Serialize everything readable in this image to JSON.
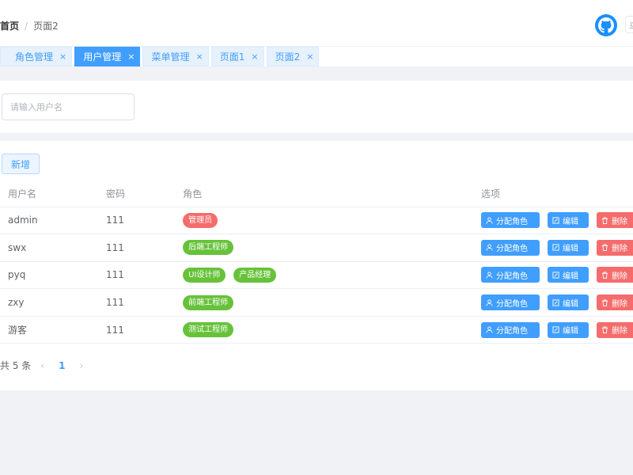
{
  "breadcrumb": {
    "home": "首页",
    "sep": "/",
    "current": "页面2"
  },
  "tabs": [
    {
      "label": "角色管理",
      "close": "×"
    },
    {
      "label": "用户管理",
      "close": "×",
      "active": true
    },
    {
      "label": "菜单管理",
      "close": "×"
    },
    {
      "label": "页面1",
      "close": "×"
    },
    {
      "label": "页面2",
      "close": "×"
    }
  ],
  "header": {
    "user_button_text": "马"
  },
  "search": {
    "placeholder": "请输入用户名"
  },
  "toolbar": {
    "add_label": "新增"
  },
  "table": {
    "headers": [
      "用户名",
      "密码",
      "角色",
      "选项"
    ],
    "rows": [
      {
        "username": "admin",
        "password": "111",
        "roles": [
          {
            "label": "管理员",
            "color": "red"
          }
        ]
      },
      {
        "username": "swx",
        "password": "111",
        "roles": [
          {
            "label": "后端工程师",
            "color": "green"
          }
        ]
      },
      {
        "username": "pyq",
        "password": "111",
        "roles": [
          {
            "label": "UI设计师",
            "color": "green"
          },
          {
            "label": "产品经理",
            "color": "green"
          }
        ]
      },
      {
        "username": "zxy",
        "password": "111",
        "roles": [
          {
            "label": "前端工程师",
            "color": "green"
          }
        ]
      },
      {
        "username": "游客",
        "password": "111",
        "roles": [
          {
            "label": "测试工程师",
            "color": "green"
          }
        ]
      }
    ],
    "actions": {
      "assign": "分配角色",
      "edit": "编辑",
      "delete": "删除"
    }
  },
  "pagination": {
    "total_text": "共 5 条",
    "prev": "‹",
    "page": "1",
    "next": "›"
  },
  "colors": {
    "primary": "#409eff",
    "danger": "#f56c6c",
    "success": "#67c23a",
    "github": "#1890ff"
  }
}
